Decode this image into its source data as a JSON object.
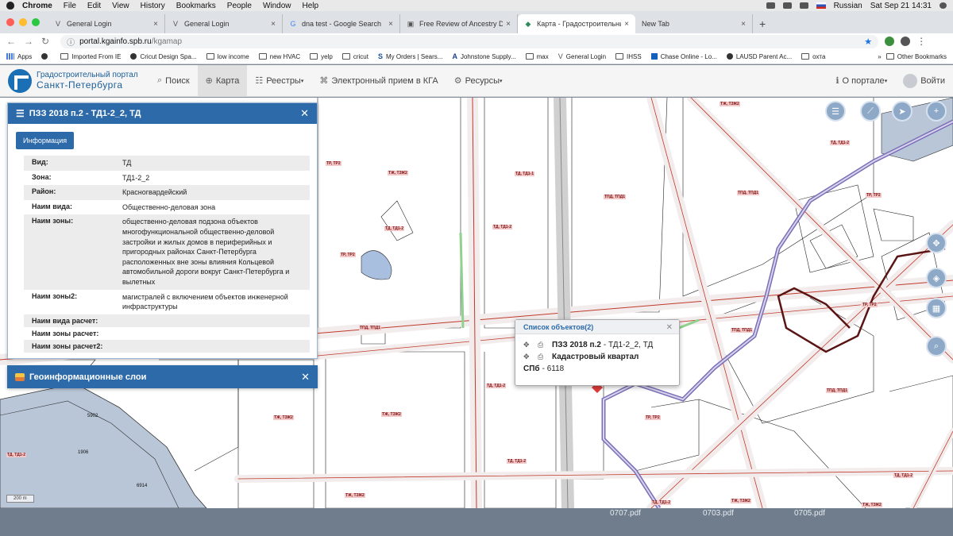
{
  "menubar": {
    "app": "Chrome",
    "items": [
      "File",
      "Edit",
      "View",
      "History",
      "Bookmarks",
      "People",
      "Window",
      "Help"
    ],
    "language": "Russian",
    "clock": "Sat Sep 21  14:31"
  },
  "tabs": [
    {
      "icon": "V",
      "title": "General Login"
    },
    {
      "icon": "V",
      "title": "General Login"
    },
    {
      "icon": "G",
      "title": "dna test - Google Search"
    },
    {
      "icon": "▣",
      "title": "Free Review of Ancestry Dna T"
    },
    {
      "icon": "◆",
      "title": "Карта - Градостроительный п",
      "active": true
    },
    {
      "icon": "",
      "title": "New Tab"
    }
  ],
  "toolbar": {
    "url_host": "portal.kgainfo.spb.ru",
    "url_path": "/kgamap"
  },
  "bookmarks": [
    {
      "label": "Apps",
      "icon": "apps"
    },
    {
      "label": "",
      "icon": "circle"
    },
    {
      "label": "Imported From IE",
      "icon": "folder"
    },
    {
      "label": "Cricut Design Spa...",
      "icon": "circle"
    },
    {
      "label": "low income",
      "icon": "folder"
    },
    {
      "label": "new HVAC",
      "icon": "folder"
    },
    {
      "label": "yelp",
      "icon": "folder"
    },
    {
      "label": "cricut",
      "icon": "folder"
    },
    {
      "label": "My Orders | Sears...",
      "icon": "S"
    },
    {
      "label": "Johnstone Supply...",
      "icon": "A"
    },
    {
      "label": "max",
      "icon": "folder"
    },
    {
      "label": "General Login",
      "icon": "V"
    },
    {
      "label": "IHSS",
      "icon": "folder"
    },
    {
      "label": "Chase Online - Lo...",
      "icon": "circle"
    },
    {
      "label": "LAUSD Parent Ac...",
      "icon": "circle"
    },
    {
      "label": "охта",
      "icon": "folder"
    }
  ],
  "bookmarks_other": "Other Bookmarks",
  "site": {
    "logo_line1": "Градостроительный портал",
    "logo_line2": "Санкт-Петербурга",
    "nav": [
      {
        "label": "Поиск",
        "icon": "⌕"
      },
      {
        "label": "Карта",
        "icon": "⊕",
        "active": true
      },
      {
        "label": "Реестры",
        "icon": "☷",
        "dropdown": true
      },
      {
        "label": "Электронный прием в КГА",
        "icon": "⌘"
      },
      {
        "label": "Ресурсы",
        "icon": "⚙",
        "dropdown": true
      }
    ],
    "about": "О портале",
    "login": "Войти"
  },
  "info_panel": {
    "title": "ПЗЗ 2018 п.2 - ТД1-2_2, ТД",
    "tab_button": "Информация",
    "rows": [
      {
        "key": "Вид:",
        "value": "ТД"
      },
      {
        "key": "Зона:",
        "value": "ТД1-2_2"
      },
      {
        "key": "Район:",
        "value": "Красногвардейский"
      },
      {
        "key": "Наим вида:",
        "value": "Общественно-деловая зона"
      },
      {
        "key": "Наим зоны:",
        "value": "общественно-деловая подзона объектов многофункциональной общественно-деловой застройки и жилых домов в периферийных и пригородных районах Санкт-Петербурга расположенных вне зоны влияния Кольцевой автомобильной дороги вокруг Санкт-Петербурга и вылетных"
      },
      {
        "key": "Наим зоны2:",
        "value": "магистралей с включением объектов инженерной инфраструктуры"
      },
      {
        "key": "Наим вида расчет:",
        "value": ""
      },
      {
        "key": "Наим зоны расчет:",
        "value": ""
      },
      {
        "key": "Наим зоны расчет2:",
        "value": ""
      }
    ]
  },
  "layers_panel": {
    "title": "Геоинформационные слои"
  },
  "popup": {
    "title": "Список объектов(2)",
    "item1_bold": "ПЗЗ 2018 п.2",
    "item1_rest": "- ТД1-2_2, ТД",
    "item2_bold": "Кадастровый квартал",
    "item3_bold": "СПб",
    "item3_rest": "- 6118"
  },
  "scale": "200 m",
  "parcels": [
    "5902",
    "1906",
    "6914"
  ],
  "zone_labels": [
    "ТД, ТД1-2",
    "ТЖ, ТЗЖ2",
    "ТР, ТР2",
    "ТПД, ТПД1",
    "ТД, ТД1-2",
    "ТД, ТД1-2",
    "ТЖ, ТЗЖ2",
    "ТПД, ТПД1",
    "ТР, ТР2",
    "ТД, ТД1-2",
    "ТЖ, ТЗЖ2",
    "ТД, ТД1-1",
    "ТР, ТР2",
    "ТПД, ТПД1",
    "ТД, ТД1-2",
    "ТПД, ТПД1",
    "ТР, ТР2",
    "ТЖ, ТЗЖ2",
    "ТПД, ТПД1",
    "ТД, ТД1-2",
    "ТЖ, ТЗЖ2",
    "ТД, ТД1-2",
    "ТЖ, ТЗЖ2",
    "ТР, ТР2",
    "ТЖ, ТЗЖ2",
    "ТД, ТД1-2"
  ],
  "dock_files": [
    "0707.pdf",
    "0703.pdf",
    "0705.pdf"
  ]
}
